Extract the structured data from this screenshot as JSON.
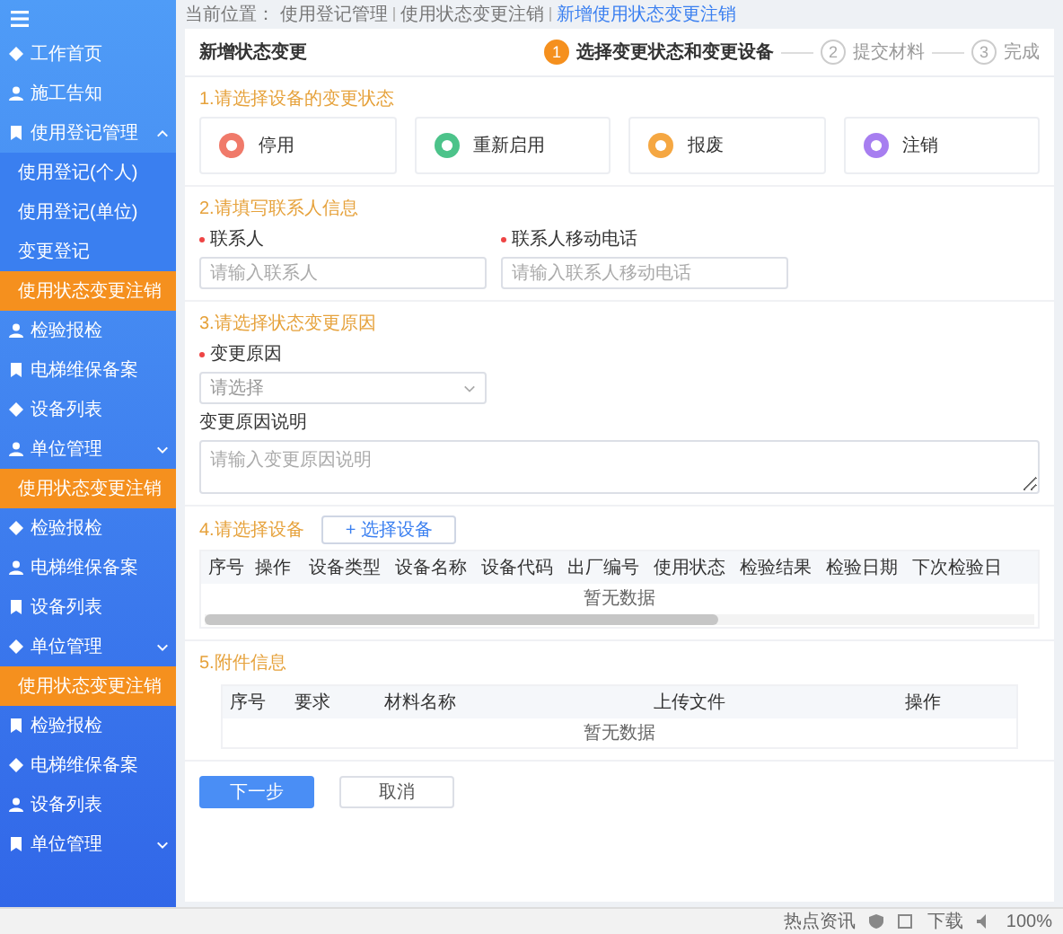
{
  "sidebar": {
    "items": [
      {
        "label": "工作首页",
        "kind": "item",
        "selected": false
      },
      {
        "label": "施工告知",
        "kind": "item",
        "selected": false
      },
      {
        "label": "使用登记管理",
        "kind": "group",
        "expanded": true,
        "selected": false
      },
      {
        "label": "使用登记(个人)",
        "kind": "sub",
        "selected": false
      },
      {
        "label": "使用登记(单位)",
        "kind": "sub",
        "selected": false
      },
      {
        "label": "变更登记",
        "kind": "sub",
        "selected": false
      },
      {
        "label": "使用状态变更注销",
        "kind": "sub",
        "selected": true
      },
      {
        "label": "检验报检",
        "kind": "item",
        "selected": false
      },
      {
        "label": "电梯维保备案",
        "kind": "item",
        "selected": false
      },
      {
        "label": "设备列表",
        "kind": "item",
        "selected": false
      },
      {
        "label": "单位管理",
        "kind": "group",
        "expanded": false,
        "selected": false
      },
      {
        "label": "使用状态变更注销",
        "kind": "sub",
        "selected": true
      },
      {
        "label": "检验报检",
        "kind": "item",
        "selected": false
      },
      {
        "label": "电梯维保备案",
        "kind": "item",
        "selected": false
      },
      {
        "label": "设备列表",
        "kind": "item",
        "selected": false
      },
      {
        "label": "单位管理",
        "kind": "group",
        "expanded": false,
        "selected": false
      },
      {
        "label": "使用状态变更注销",
        "kind": "sub",
        "selected": true
      },
      {
        "label": "检验报检",
        "kind": "item",
        "selected": false
      },
      {
        "label": "电梯维保备案",
        "kind": "item",
        "selected": false
      },
      {
        "label": "设备列表",
        "kind": "item",
        "selected": false
      },
      {
        "label": "单位管理",
        "kind": "group",
        "expanded": false,
        "selected": false
      }
    ]
  },
  "breadcrumb": [
    "当前位置：",
    "使用登记管理",
    "使用状态变更注销",
    "新增使用状态变更注销"
  ],
  "page_title": "新增状态变更",
  "steps": [
    {
      "number": "1",
      "label": "选择变更状态和变更设备",
      "active": true
    },
    {
      "number": "2",
      "label": "提交材料",
      "active": false
    },
    {
      "number": "3",
      "label": "完成",
      "active": false
    }
  ],
  "section_1": {
    "title": "1.请选择设备的变更状态",
    "options": [
      {
        "label": "停用",
        "color": "#f07a6a",
        "selected": false
      },
      {
        "label": "重新启用",
        "color": "#4cc38a",
        "selected": false
      },
      {
        "label": "报废",
        "color": "#f5a742",
        "selected": false
      },
      {
        "label": "注销",
        "color": "#a77ef0",
        "selected": false
      }
    ]
  },
  "section_2": {
    "title": "2.请填写联系人信息",
    "fields": [
      {
        "label": "联系人",
        "required": true,
        "placeholder": "请输入联系人"
      },
      {
        "label": "联系人移动电话",
        "required": true,
        "placeholder": "请输入联系人移动电话"
      }
    ]
  },
  "section_3": {
    "title": "3.请选择状态变更原因",
    "reason": {
      "label": "变更原因",
      "required": true,
      "placeholder": "请选择"
    },
    "description": {
      "label": "变更原因说明",
      "required": false,
      "placeholder": "请输入变更原因说明"
    }
  },
  "section_4": {
    "title": "4.请选择设备",
    "add_button": "+ 选择设备",
    "table": {
      "columns": [
        "序号",
        "操作",
        "设备类型",
        "设备名称",
        "设备代码",
        "出厂编号",
        "使用状态",
        "检验结果",
        "检验日期",
        "下次检验日"
      ],
      "empty_text": "暂无数据"
    }
  },
  "section_5": {
    "title": "5.附件信息",
    "table": {
      "columns": [
        "序号",
        "要求",
        "材料名称",
        "上传文件",
        "操作"
      ],
      "empty_text": "暂无数据"
    }
  },
  "buttons": {
    "next": "下一步",
    "cancel": "取消"
  },
  "status_bar": {
    "news": "热点资讯",
    "download": "下载",
    "zoom": "100%"
  }
}
